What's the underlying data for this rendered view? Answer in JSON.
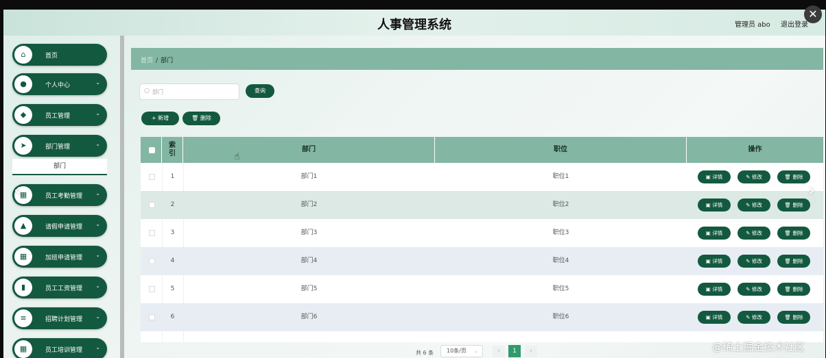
{
  "header": {
    "title": "人事管理系统",
    "user": "管理员 abo",
    "logout": "退出登录"
  },
  "close_icon": "✕",
  "sidebar": {
    "items": [
      {
        "label": "首页",
        "icon": "home-icon",
        "glyph": "⌂",
        "has_children": false
      },
      {
        "label": "个人中心",
        "icon": "user-icon",
        "glyph": "●",
        "has_children": true
      },
      {
        "label": "员工管理",
        "icon": "staff-icon",
        "glyph": "◆",
        "has_children": true
      },
      {
        "label": "部门管理",
        "icon": "send-icon",
        "glyph": "➤",
        "has_children": true,
        "expanded": true
      },
      {
        "label": "员工考勤管理",
        "icon": "grid-icon",
        "glyph": "▦",
        "has_children": true
      },
      {
        "label": "请假申请管理",
        "icon": "person-icon",
        "glyph": "▲",
        "has_children": true
      },
      {
        "label": "加班申请管理",
        "icon": "grid-icon",
        "glyph": "▦",
        "has_children": true
      },
      {
        "label": "员工工资管理",
        "icon": "bar-chart-icon",
        "glyph": "▮",
        "has_children": true
      },
      {
        "label": "招聘计划管理",
        "icon": "list-icon",
        "glyph": "≡",
        "has_children": true
      },
      {
        "label": "员工培训管理",
        "icon": "grid-icon",
        "glyph": "▦",
        "has_children": true
      }
    ],
    "submenu": {
      "label": "部门"
    },
    "chevron": "⌄"
  },
  "breadcrumb": {
    "home": "首页",
    "separator": "/",
    "current": "部门"
  },
  "search": {
    "placeholder": "部门",
    "button": "查询"
  },
  "toolbar": {
    "add": "+ 新增",
    "delete": "🗑 删除"
  },
  "table": {
    "headers": {
      "index": "索\n引",
      "department": "部门",
      "position": "职位",
      "actions": "操作"
    },
    "actions": {
      "detail": "▣ 详情",
      "edit": "✎ 修改",
      "delete": "🗑 删除"
    },
    "rows": [
      {
        "index": "1",
        "department": "部门1",
        "position": "职位1"
      },
      {
        "index": "2",
        "department": "部门2",
        "position": "职位2"
      },
      {
        "index": "3",
        "department": "部门3",
        "position": "职位3"
      },
      {
        "index": "4",
        "department": "部门4",
        "position": "职位4"
      },
      {
        "index": "5",
        "department": "部门5",
        "position": "职位5"
      },
      {
        "index": "6",
        "department": "部门6",
        "position": "职位6"
      }
    ]
  },
  "pagination": {
    "total": "共 6 条",
    "page_size": "10条/页",
    "prev": "‹",
    "current": "1",
    "next": "›"
  },
  "carousel": {
    "prev": "‹",
    "next": "›"
  },
  "watermark": "@稀土掘金技术社区",
  "colors": {
    "primary": "#13593f",
    "header_bar": "#83b6a3",
    "active_page": "#2f9a6c"
  }
}
